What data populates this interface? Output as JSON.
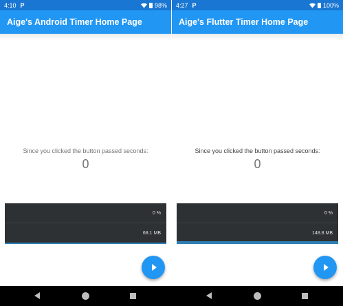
{
  "colors": {
    "primary": "#2196f3",
    "status_bar": "#1976d2",
    "perf_panel": "#2e3133",
    "perf_bar": "#2e7fb5"
  },
  "android": {
    "status": {
      "time": "4:10",
      "notification": "P",
      "battery": "98%"
    },
    "title": "Aige's Android Timer Home Page",
    "caption": "Since you clicked the button passed seconds:",
    "counter": "0",
    "perf": {
      "cpu": "0 %",
      "memory": "68.1 MB",
      "memory_fill": 0.08
    }
  },
  "flutter": {
    "status": {
      "time": "4:27",
      "notification": "P",
      "battery": "100%"
    },
    "title": "Aige's Flutter Timer Home Page",
    "caption": "Since you clicked the button passed seconds:",
    "counter": "0",
    "perf": {
      "cpu": "0 %",
      "memory": "148.8 MB",
      "memory_fill": 0.15
    }
  },
  "icons": {
    "fab": "play-icon",
    "nav_back": "back-triangle-icon",
    "nav_home": "home-circle-icon",
    "nav_recent": "recent-square-icon"
  }
}
